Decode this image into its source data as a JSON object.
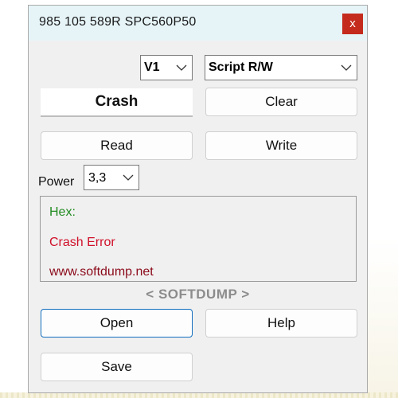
{
  "window": {
    "title": "985 105 589R SPC560P50",
    "close_glyph": "x"
  },
  "controls": {
    "version_select": {
      "value": "V1"
    },
    "mode_select": {
      "value": "Script R/W"
    },
    "power_label": "Power",
    "power_select": {
      "value": "3,3"
    }
  },
  "buttons": {
    "crash": "Crash",
    "clear": "Clear",
    "read": "Read",
    "write": "Write",
    "open": "Open",
    "help": "Help",
    "save": "Save"
  },
  "log": {
    "lines": [
      {
        "text": "Hex:",
        "color": "#228b22"
      },
      {
        "text": "Crash Error",
        "color": "#d0102a"
      },
      {
        "text": "www.softdump.net",
        "color": "#8b0a1a"
      }
    ]
  },
  "brand": "< SOFTDUMP >",
  "colors": {
    "close_red": "#c42b1c",
    "titlebar": "#e6f4f8",
    "focus_blue": "#0f6cbd"
  }
}
